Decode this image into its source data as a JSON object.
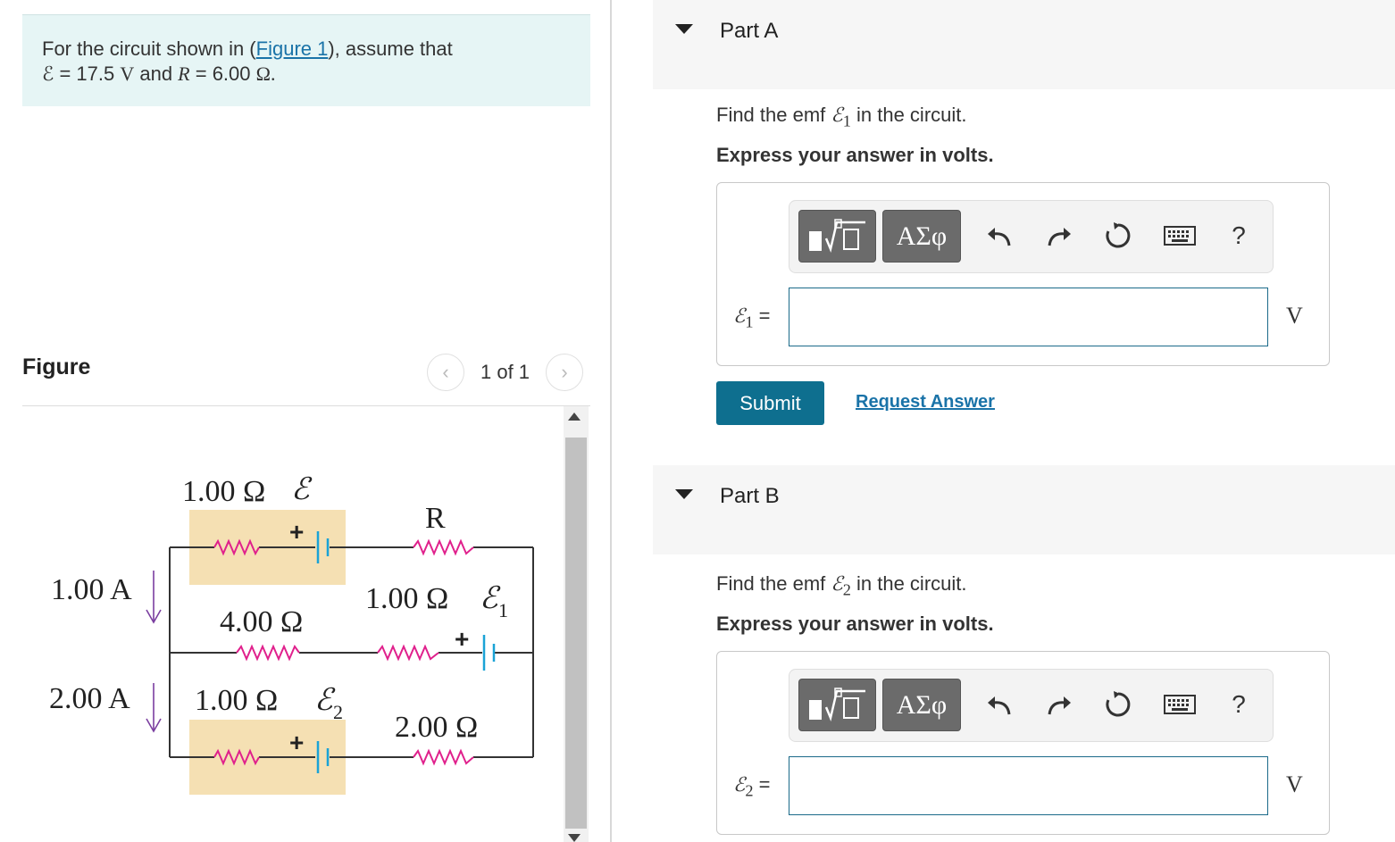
{
  "problem": {
    "prefix": "For the circuit shown in (",
    "figure_link": "Figure 1",
    "suffix": "), assume that",
    "line2_emf_sym": "ℰ",
    "line2_emf_val": " = 17.5 ",
    "line2_unit_v": "V",
    "line2_and": " and ",
    "line2_r_sym": "R",
    "line2_r_val": " = 6.00 ",
    "line2_unit_ohm": "Ω."
  },
  "figure": {
    "label": "Figure",
    "pager_text": "1 of 1",
    "circuit": {
      "top_res_label": "1.00 Ω",
      "top_emf_label": "ℰ",
      "r_label": "R",
      "current_top": "1.00 A",
      "mid_left_res": "4.00 Ω",
      "mid_right_res": "1.00 Ω",
      "mid_emf": "ℰ",
      "mid_emf_sub": "1",
      "current_bottom": "2.00 A",
      "bot_res_label": "1.00 Ω",
      "bot_emf": "ℰ",
      "bot_emf_sub": "2",
      "bot_right_res": "2.00 Ω",
      "plus": "+",
      "colors": {
        "resistor": "#e0208c",
        "battery": "#1aa3d6",
        "highlight": "#f5e0b3",
        "wire": "#333333"
      }
    }
  },
  "parts": [
    {
      "title": "Part A",
      "question_prefix": "Find the emf ",
      "question_sym": "ℰ",
      "question_sub": "1",
      "question_suffix": " in the circuit.",
      "instruction": "Express your answer in volts.",
      "answer_sym": "ℰ",
      "answer_sub": "1",
      "answer_eq": " =",
      "answer_value": "",
      "unit": "V",
      "toolbar": {
        "greek": "ΑΣφ",
        "help": "?"
      }
    },
    {
      "title": "Part B",
      "question_prefix": "Find the emf ",
      "question_sym": "ℰ",
      "question_sub": "2",
      "question_suffix": " in the circuit.",
      "instruction": "Express your answer in volts.",
      "answer_sym": "ℰ",
      "answer_sub": "2",
      "answer_eq": " =",
      "answer_value": "",
      "unit": "V",
      "toolbar": {
        "greek": "ΑΣφ",
        "help": "?"
      }
    }
  ],
  "actions": {
    "submit": "Submit",
    "request": "Request Answer"
  },
  "icons": [
    "template-icon",
    "greek-icon",
    "undo-icon",
    "redo-icon",
    "reset-icon",
    "keyboard-icon",
    "help-icon",
    "caret-down-icon",
    "chevron-left-icon",
    "chevron-right-icon"
  ]
}
